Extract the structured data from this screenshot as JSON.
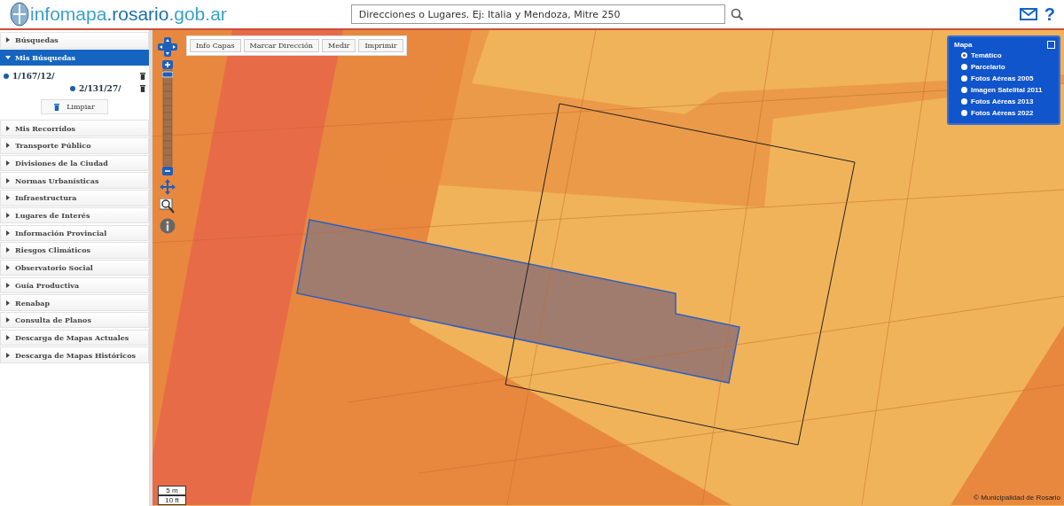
{
  "header": {
    "logo_text": "infomapa",
    "logo_domain": ".rosario",
    "logo_suffix": ".gob.ar",
    "search": {
      "placeholder": "Direcciones o Lugares. Ej: Italia y Mendoza, Mitre 250"
    },
    "help_label": "?"
  },
  "zoom_slider": {
    "level": 0.98
  },
  "sidebar": {
    "items": [
      {
        "label": "Búsquedas",
        "expanded": false
      },
      {
        "label": "Mis Búsquedas",
        "expanded": true,
        "searches": [
          "1/167/12/",
          "2/131/27/"
        ],
        "clear_button": "Limpiar"
      },
      {
        "label": "Mis Recorridos",
        "expanded": false
      },
      {
        "label": "Transporte Público",
        "expanded": false
      },
      {
        "label": "Divisiones de la Ciudad",
        "expanded": false
      },
      {
        "label": "Normas Urbanísticas",
        "expanded": false
      },
      {
        "label": "Infraestructura",
        "expanded": false
      },
      {
        "label": "Lugares de Interés",
        "expanded": false
      },
      {
        "label": "Información Provincial",
        "expanded": false
      },
      {
        "label": "Riesgos Climáticos",
        "expanded": false
      },
      {
        "label": "Observatorio Social",
        "expanded": false
      },
      {
        "label": "Guía Productiva",
        "expanded": false
      },
      {
        "label": "Renabap",
        "expanded": false
      },
      {
        "label": "Consulta de Planos",
        "expanded": false
      },
      {
        "label": "Descarga de Mapas Actuales",
        "expanded": false
      },
      {
        "label": "Descarga de Mapas Históricos",
        "expanded": false
      }
    ]
  },
  "map_toolbar": [
    "Info Capas",
    "Marcar Dirección",
    "Medir",
    "Imprimir"
  ],
  "base_map_panel": {
    "title": "Mapa",
    "options": [
      {
        "label": "Temático",
        "selected": true
      },
      {
        "label": "Parcelario",
        "selected": false
      },
      {
        "label": "Fotos Aéreas 2005",
        "selected": false
      },
      {
        "label": "Imagen Satelital 2011",
        "selected": false
      },
      {
        "label": "Fotos Aéreas 2013",
        "selected": false
      },
      {
        "label": "Fotos Aéreas 2022",
        "selected": false
      }
    ]
  },
  "scale_bar": {
    "metric": "5 m",
    "imperial": "10 ft"
  },
  "attribution": "© Municipalidad de Rosario"
}
